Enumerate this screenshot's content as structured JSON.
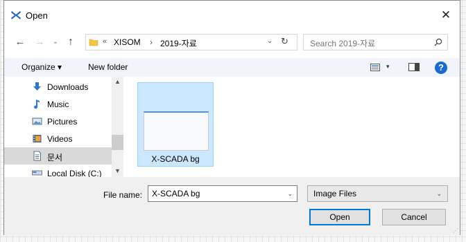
{
  "window": {
    "title": "Open",
    "close_glyph": "✕"
  },
  "navigation": {
    "back_glyph": "←",
    "forward_glyph": "→",
    "recent_glyph": "⌄",
    "up_glyph": "↑",
    "address": {
      "chevron": "«",
      "crumbs": [
        "XISOM",
        "2019-자료"
      ],
      "separator": "›",
      "dropdown_glyph": "⌄",
      "refresh_glyph": "↻"
    },
    "search": {
      "placeholder": "Search 2019-자료"
    }
  },
  "toolbar": {
    "organize_label": "Organize ▾",
    "new_folder_label": "New folder",
    "view_dropdown_glyph": "▾",
    "help_glyph": "?"
  },
  "sidebar": {
    "items": [
      {
        "label": "Downloads",
        "icon": "download-arrow-icon"
      },
      {
        "label": "Music",
        "icon": "music-note-icon"
      },
      {
        "label": "Pictures",
        "icon": "pictures-icon"
      },
      {
        "label": "Videos",
        "icon": "video-icon"
      },
      {
        "label": "문서",
        "icon": "document-icon",
        "selected": true
      },
      {
        "label": "Local Disk (C:)",
        "icon": "disk-icon"
      }
    ],
    "scroll_up_glyph": "▲",
    "scroll_down_glyph": "▼"
  },
  "files": [
    {
      "name": "X-SCADA bg",
      "selected": true
    }
  ],
  "footer": {
    "file_name_label": "File name:",
    "file_name_value": "X-SCADA bg",
    "file_name_dd_glyph": "⌄",
    "file_type_value": "Image Files",
    "file_type_dd_glyph": "⌄",
    "open_label": "Open",
    "cancel_label": "Cancel"
  },
  "colors": {
    "accent": "#0078d7",
    "selection": "#cce8ff",
    "toolbar_bg": "#f1f5fb",
    "footer_bg": "#f0f0f0"
  }
}
